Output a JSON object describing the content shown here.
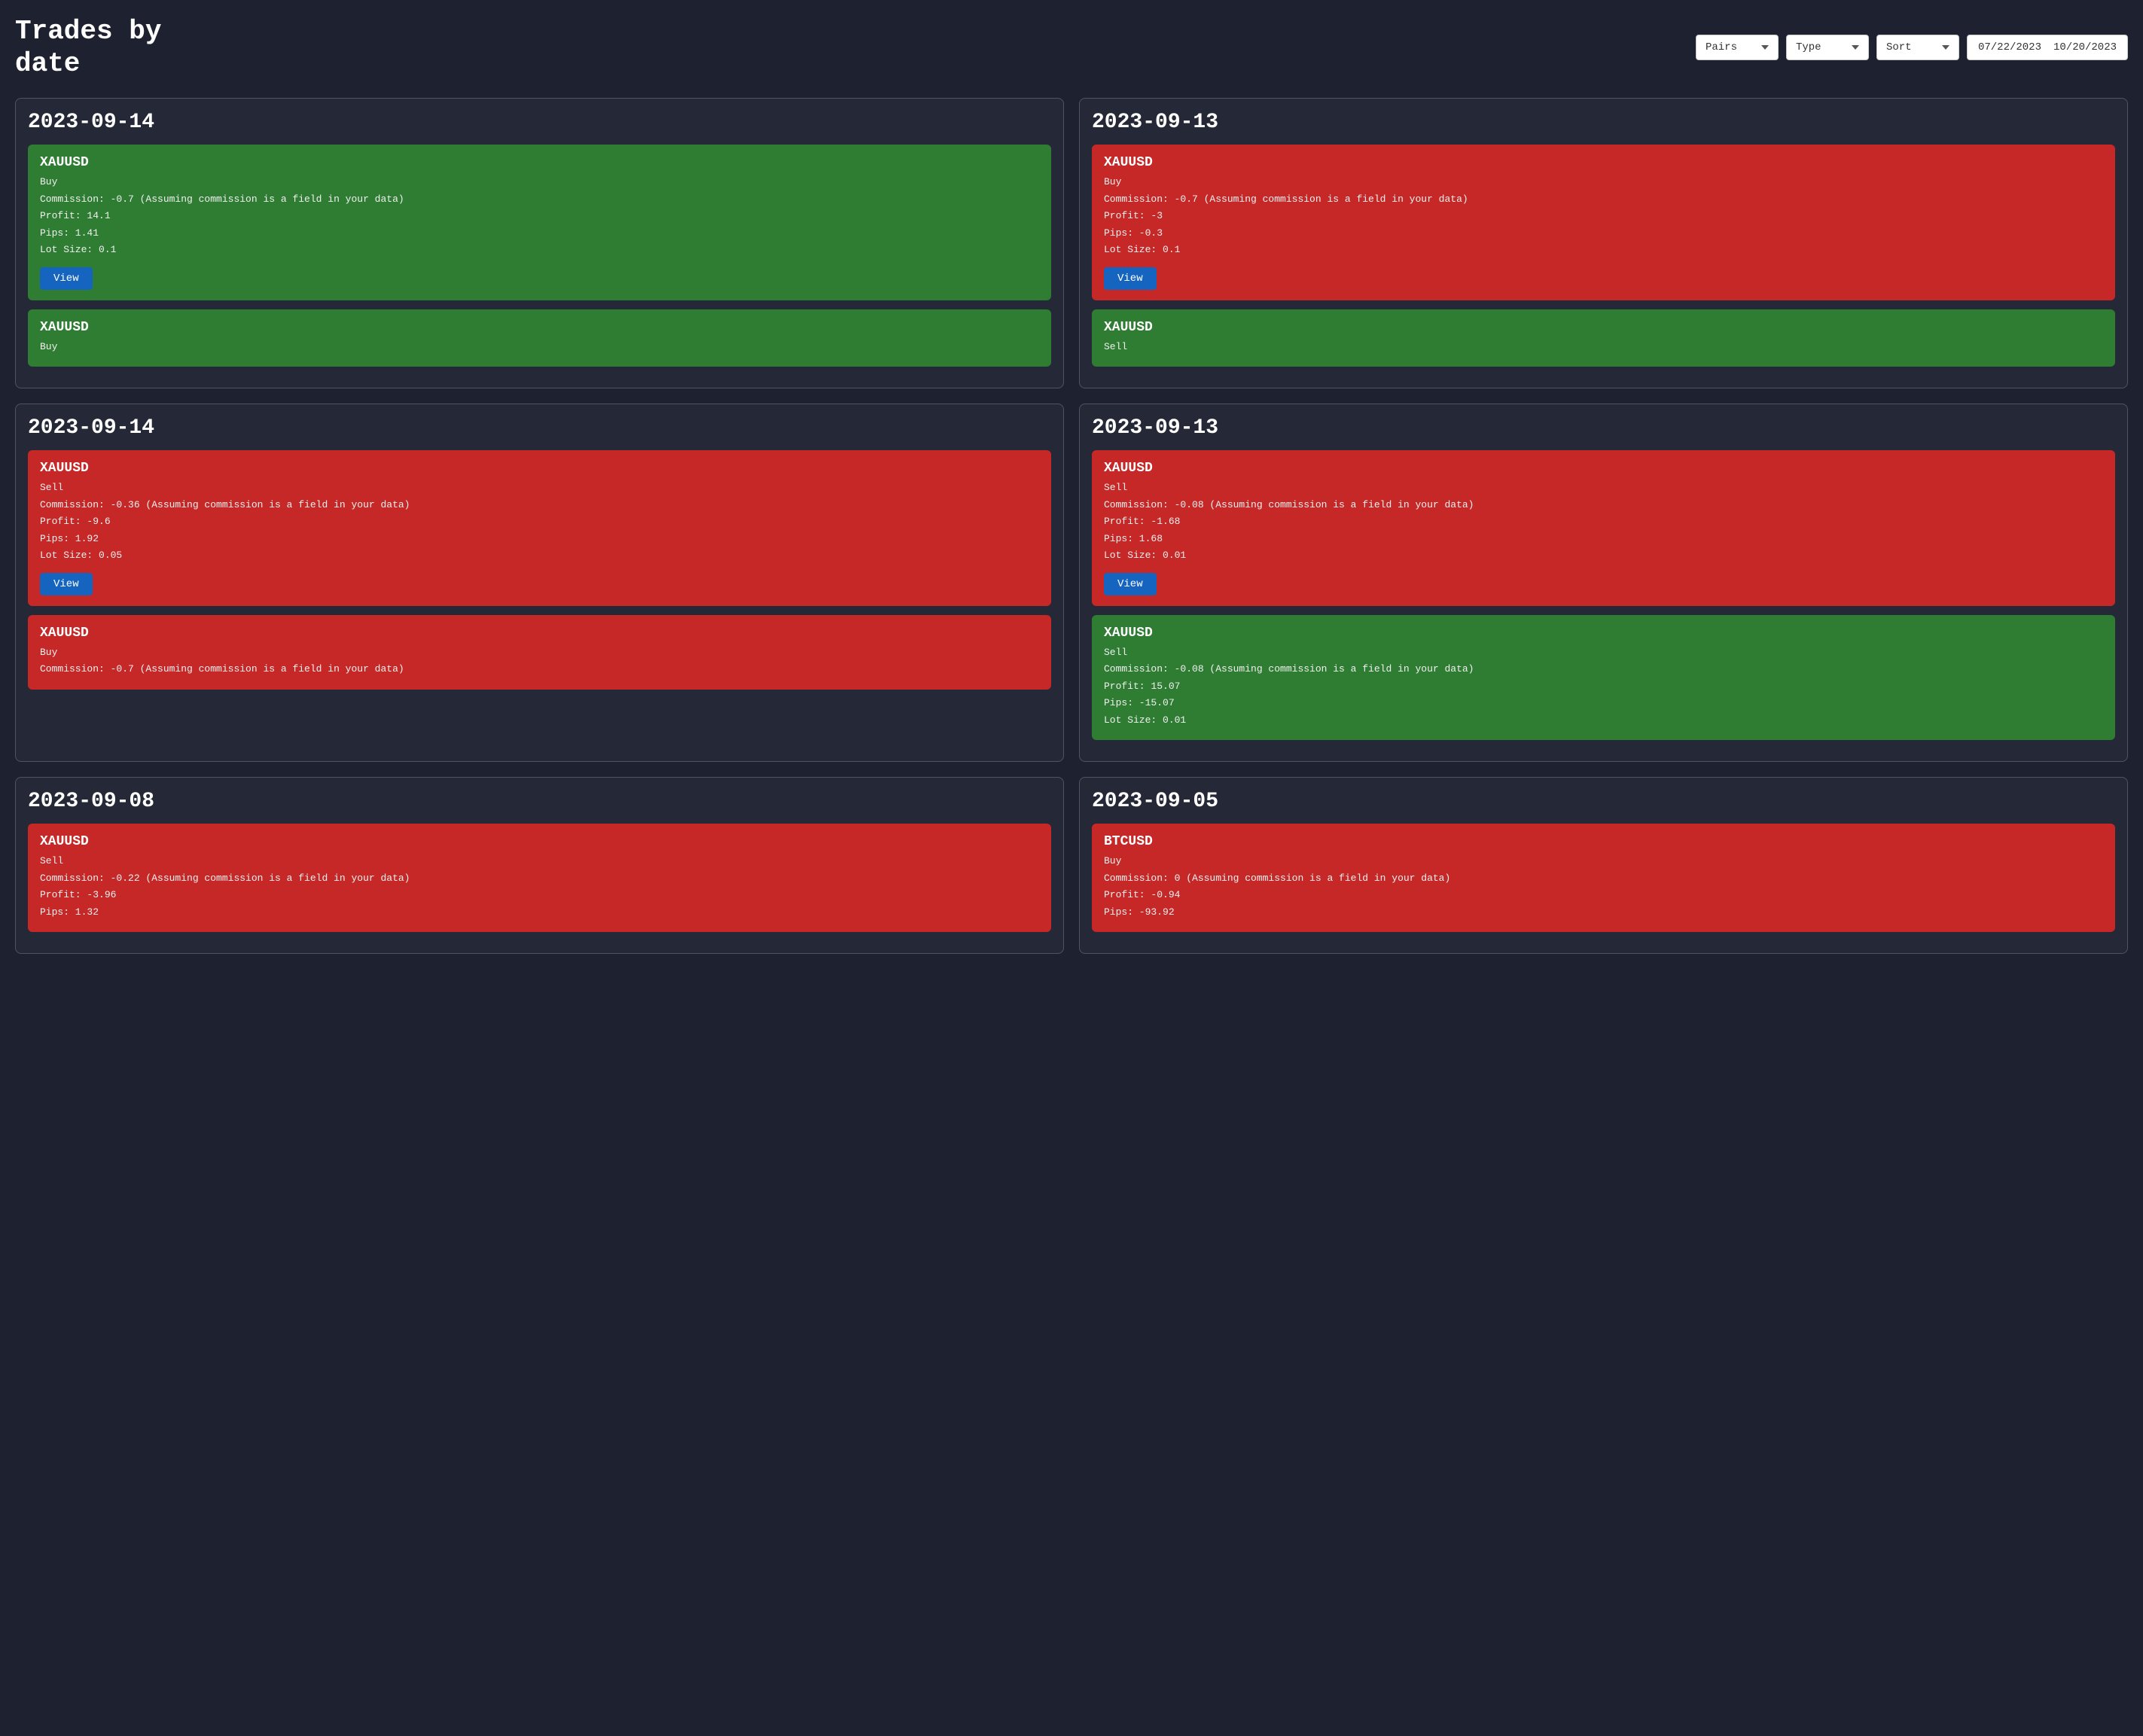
{
  "header": {
    "title": "Trades by date",
    "pairs_label": "Pairs",
    "type_label": "Type",
    "sort_label": "Sort",
    "date_start": "07/22/2023",
    "date_end": "10/20/2023"
  },
  "date_sections": [
    {
      "id": "section-2023-09-14",
      "date": "2023-09-14",
      "trades": [
        {
          "symbol": "XAUUSD",
          "direction": "Buy",
          "commission": "Commission: -0.7 (Assuming commission is a field in your data)",
          "profit": "Profit: 14.1",
          "pips": "Pips: 1.41",
          "lot_size": "Lot Size: 0.1",
          "color": "green",
          "show_button": true
        },
        {
          "symbol": "XAUUSD",
          "direction": "Buy",
          "commission": "",
          "profit": "",
          "pips": "",
          "lot_size": "",
          "color": "green",
          "show_button": false
        }
      ]
    },
    {
      "id": "section-2023-09-13",
      "date": "2023-09-13",
      "trades": [
        {
          "symbol": "XAUUSD",
          "direction": "Buy",
          "commission": "Commission: -0.7 (Assuming commission is a field in your data)",
          "profit": "Profit: -3",
          "pips": "Pips: -0.3",
          "lot_size": "Lot Size: 0.1",
          "color": "red",
          "show_button": true
        },
        {
          "symbol": "XAUUSD",
          "direction": "Sell",
          "commission": "",
          "profit": "",
          "pips": "",
          "lot_size": "",
          "color": "green",
          "show_button": false
        }
      ]
    },
    {
      "id": "section-2023-09-14-b",
      "date": "2023-09-14",
      "trades": [
        {
          "symbol": "XAUUSD",
          "direction": "Sell",
          "commission": "Commission: -0.36 (Assuming commission is a field in your data)",
          "profit": "Profit: -9.6",
          "pips": "Pips: 1.92",
          "lot_size": "Lot Size: 0.05",
          "color": "red",
          "show_button": true
        },
        {
          "symbol": "XAUUSD",
          "direction": "Buy",
          "commission": "Commission: -0.7 (Assuming commission is a field in your data)",
          "profit": "",
          "pips": "",
          "lot_size": "",
          "color": "red",
          "show_button": false
        }
      ]
    },
    {
      "id": "section-2023-09-13-b",
      "date": "2023-09-13",
      "trades": [
        {
          "symbol": "XAUUSD",
          "direction": "Sell",
          "commission": "Commission: -0.08 (Assuming commission is a field in your data)",
          "profit": "Profit: -1.68",
          "pips": "Pips: 1.68",
          "lot_size": "Lot Size: 0.01",
          "color": "red",
          "show_button": true
        },
        {
          "symbol": "XAUUSD",
          "direction": "Sell",
          "commission": "Commission: -0.08 (Assuming commission is a field in your data)",
          "profit": "Profit: 15.07",
          "pips": "Pips: -15.07",
          "lot_size": "Lot Size: 0.01",
          "color": "green",
          "show_button": false
        }
      ]
    },
    {
      "id": "section-2023-09-08",
      "date": "2023-09-08",
      "trades": [
        {
          "symbol": "XAUUSD",
          "direction": "Sell",
          "commission": "Commission: -0.22 (Assuming commission is a field in your data)",
          "profit": "Profit: -3.96",
          "pips": "Pips: 1.32",
          "lot_size": "",
          "color": "red",
          "show_button": false
        }
      ]
    },
    {
      "id": "section-2023-09-05",
      "date": "2023-09-05",
      "trades": [
        {
          "symbol": "BTCUSD",
          "direction": "Buy",
          "commission": "Commission: 0 (Assuming commission is a field in your data)",
          "profit": "Profit: -0.94",
          "pips": "Pips: -93.92",
          "lot_size": "",
          "color": "red",
          "show_button": false
        }
      ]
    }
  ],
  "buttons": {
    "view_label": "View"
  }
}
